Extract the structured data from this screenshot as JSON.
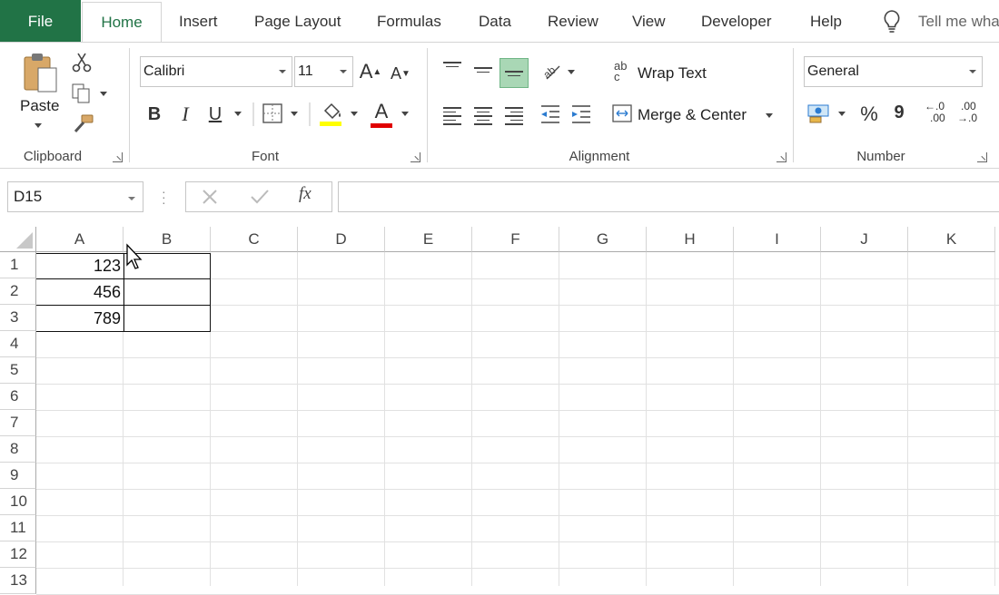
{
  "tabs": {
    "file": "File",
    "home": "Home",
    "insert": "Insert",
    "page_layout": "Page Layout",
    "formulas": "Formulas",
    "data": "Data",
    "review": "Review",
    "view": "View",
    "developer": "Developer",
    "help": "Help",
    "tell_me": "Tell me wha"
  },
  "ribbon": {
    "clipboard": {
      "paste": "Paste",
      "label": "Clipboard"
    },
    "font": {
      "name": "Calibri",
      "size": "11",
      "bold": "B",
      "italic": "I",
      "underline": "U",
      "grow": "A",
      "shrink": "A",
      "color_letter": "A",
      "label": "Font"
    },
    "alignment": {
      "wrap_text": "Wrap Text",
      "merge_center": "Merge & Center",
      "label": "Alignment",
      "wrap_icon_top": "ab",
      "wrap_icon_bottom": "c"
    },
    "number": {
      "format": "General",
      "percent": "%",
      "comma": "9",
      "inc_decimal_top": "←.0",
      "inc_decimal_bottom": ".00",
      "dec_decimal_top": ".00",
      "dec_decimal_bottom": "→.0",
      "label": "Number"
    }
  },
  "formula_bar": {
    "name_box": "D15",
    "fx": "fx",
    "formula": ""
  },
  "grid": {
    "columns": [
      "A",
      "B",
      "C",
      "D",
      "E",
      "F",
      "G",
      "H",
      "I",
      "J",
      "K"
    ],
    "rows": [
      "1",
      "2",
      "3",
      "4",
      "5",
      "6",
      "7",
      "8",
      "9",
      "10",
      "11",
      "12",
      "13"
    ],
    "cells": {
      "A1": "123",
      "A2": "456",
      "A3": "789"
    }
  },
  "colors": {
    "excel_green": "#217346",
    "highlight_yellow": "#ffff00",
    "font_red": "#e00000",
    "selected_align": "#a9d7b5"
  }
}
